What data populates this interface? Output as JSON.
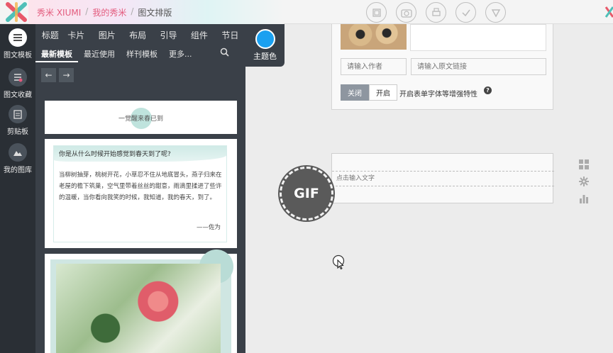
{
  "breadcrumb": {
    "brand": "秀米 XIUMI",
    "my_xiumi": "我的秀米",
    "current": "图文排版",
    "separator": "/"
  },
  "toolbar_icons": [
    "folder-icon",
    "camera-icon",
    "print-icon",
    "check-icon",
    "triangle-down-icon"
  ],
  "rail": {
    "items": [
      {
        "label": "图文模板",
        "icon": "list-icon",
        "active": true
      },
      {
        "label": "图文收藏",
        "icon": "collection-icon",
        "active": false
      },
      {
        "label": "剪贴板",
        "icon": "clipboard-icon",
        "active": false
      },
      {
        "label": "我的图库",
        "icon": "gallery-icon",
        "active": false
      }
    ]
  },
  "category_tabs": [
    "标题",
    "卡片",
    "图片",
    "布局",
    "引导",
    "组件",
    "节日"
  ],
  "sub_tabs": [
    "最新模板",
    "最近使用",
    "样刊模板",
    "更多..."
  ],
  "theme": {
    "label": "主题色",
    "color": "#1aa0f0"
  },
  "arrows": {
    "back": "←",
    "forward": "→"
  },
  "templates": {
    "card1": {
      "text": "一觉醒来春已到"
    },
    "card2": {
      "question": "你是从什么时候开始感觉到春天到了呢?",
      "body": "当柳树抽芽，桃树开花，小草忍不住从地底冒头，燕子归来在老屋的檐下筑巢，空气里带着丝丝的甜意，雨滴里揉进了些许的温暖，当你看向我笑的时候，我知道，我的春天，到了。",
      "signature": "——佐为"
    }
  },
  "editor": {
    "author_placeholder": "请输入作者",
    "link_placeholder": "请输入原文链接",
    "toggle_off": "关闭",
    "toggle_on": "开启",
    "toggle_label": "开启表单字体等增强特性",
    "help": "?",
    "text_placeholder": "点击输入文字"
  },
  "gif_badge": "GIF",
  "side_tools": [
    "grid-icon",
    "gear-icon",
    "bar-chart-icon"
  ],
  "colors": {
    "brand_pink": "#e35b7d",
    "panel_dark": "#3a4048",
    "rail_dark": "#2a2f35",
    "accent_teal": "#bfe3dd"
  }
}
